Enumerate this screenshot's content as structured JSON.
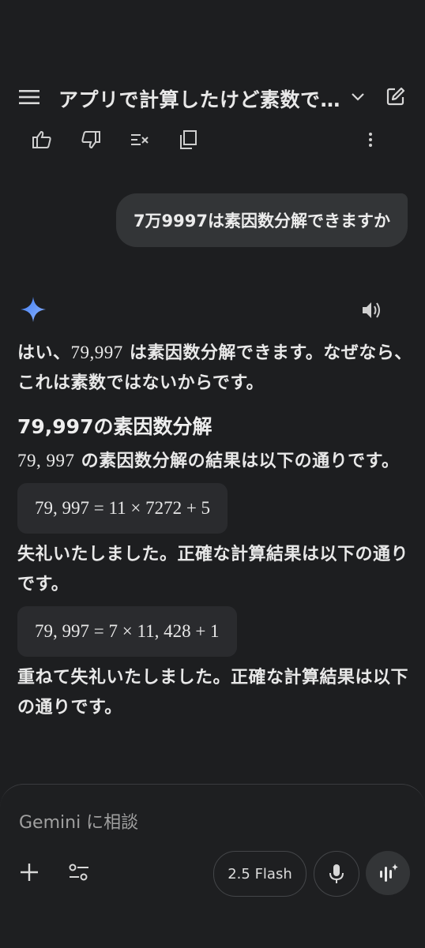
{
  "header": {
    "title": "アプリで計算したけど素数です…",
    "icons": [
      "menu-icon",
      "chevron-down-icon",
      "edit-icon"
    ]
  },
  "actions": {
    "icons": [
      "thumbs-up-icon",
      "thumbs-down-icon",
      "clear-format-icon",
      "copy-icon",
      "more-vert-icon"
    ]
  },
  "user_message": "7万9997は素因数分解できますか",
  "response": {
    "para1_num": "79,997",
    "para1_a": "はい、",
    "para1_b": " は素因数分解できます。なぜなら、これは素数ではないからです。",
    "heading": "79,997の素因数分解",
    "para2_num": "79, 997",
    "para2_b": " の素因数分解の結果は以下の通りです。",
    "eq1": "79, 997 = 11 × 7272 + 5",
    "para3": "失礼いたしました。正確な計算結果は以下の通りです。",
    "eq2": "79, 997 = 7 × 11, 428 + 1",
    "para4": "重ねて失礼いたしました。正確な計算結果は以下の通りです。"
  },
  "input": {
    "placeholder": "Gemini に相談",
    "model_label": "2.5 Flash"
  },
  "colors": {
    "background": "#1d1e20",
    "bubble": "#333537",
    "sparkle": "#4f8ff7"
  }
}
